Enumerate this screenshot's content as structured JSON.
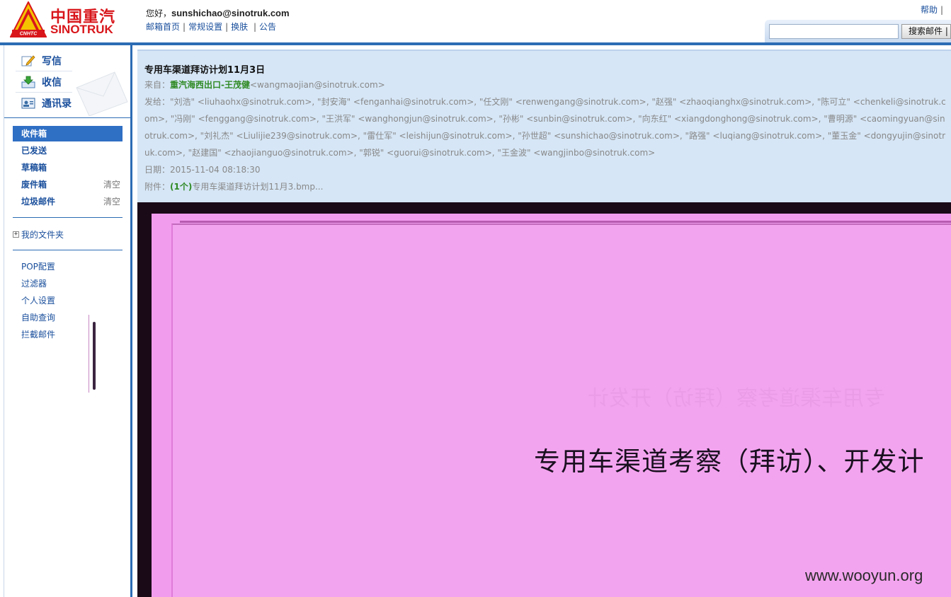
{
  "brand": {
    "name_cn": "中国重汽",
    "name_en": "SINOTRUK",
    "badge": "CNHTC",
    "accent": "#d8161b"
  },
  "header": {
    "greeting_prefix": "您好，",
    "user_email": "sunshichao@sinotruk.com",
    "links": [
      "邮箱首页",
      "常规设置",
      "换肤",
      "公告"
    ],
    "help": "帮助",
    "search_placeholder": "",
    "search_button": "搜索邮件"
  },
  "sidebar": {
    "quick": [
      {
        "label": "写信",
        "icon": "compose-icon"
      },
      {
        "label": "收信",
        "icon": "inbox-download-icon"
      },
      {
        "label": "通讯录",
        "icon": "contacts-icon"
      }
    ],
    "folders": [
      {
        "label": "收件箱",
        "active": true
      },
      {
        "label": "已发送"
      },
      {
        "label": "草稿箱"
      },
      {
        "label": "废件箱",
        "action": "清空"
      },
      {
        "label": "垃圾邮件",
        "action": "清空"
      }
    ],
    "my_folders": "我的文件夹",
    "tools": [
      "POP配置",
      "过滤器",
      "个人设置",
      "自助查询",
      "拦截邮件"
    ]
  },
  "mail": {
    "subject": "专用车渠道拜访计划11月3日",
    "from_label": "来自：",
    "from_name": "重汽海西出口-王茂健",
    "from_email": "<wangmaojian@sinotruk.com>",
    "to_label": "发给：",
    "to_text": "\"刘浩\" <liuhaohx@sinotruk.com>, \"封安海\" <fenganhai@sinotruk.com>, \"任文刚\" <renwengang@sinotruk.com>, \"赵强\" <zhaoqianghx@sinotruk.com>, \"陈可立\" <chenkeli@sinotruk.com>, \"冯刚\" <fenggang@sinotruk.com>, \"王洪军\" <wanghongjun@sinotruk.com>, \"孙彬\" <sunbin@sinotruk.com>, \"向东红\" <xiangdonghong@sinotruk.com>, \"曹明源\" <caomingyuan@sinotruk.com>, \"刘礼杰\" <Liulijie239@sinotruk.com>, \"雷仕军\" <leishijun@sinotruk.com>, \"孙世超\" <sunshichao@sinotruk.com>, \"路强\" <luqiang@sinotruk.com>, \"董玉金\" <dongyujin@sinotruk.com>, \"赵建国\" <zhaojianguo@sinotruk.com>, \"郭锐\" <guorui@sinotruk.com>, \"王金波\" <wangjinbo@sinotruk.com>",
    "date_label": "日期：",
    "date": "2015-11-04 08:18:30",
    "attach_label": "附件：",
    "attach_count": "(1个)",
    "attach_name": "专用车渠道拜访计划11月3.bmp..."
  },
  "document": {
    "title_visible": "专用车渠道考察（拜访）、开发计",
    "mirrored_text": "专用车渠道考察（拜访）开发计"
  },
  "watermark": "www.wooyun.org"
}
